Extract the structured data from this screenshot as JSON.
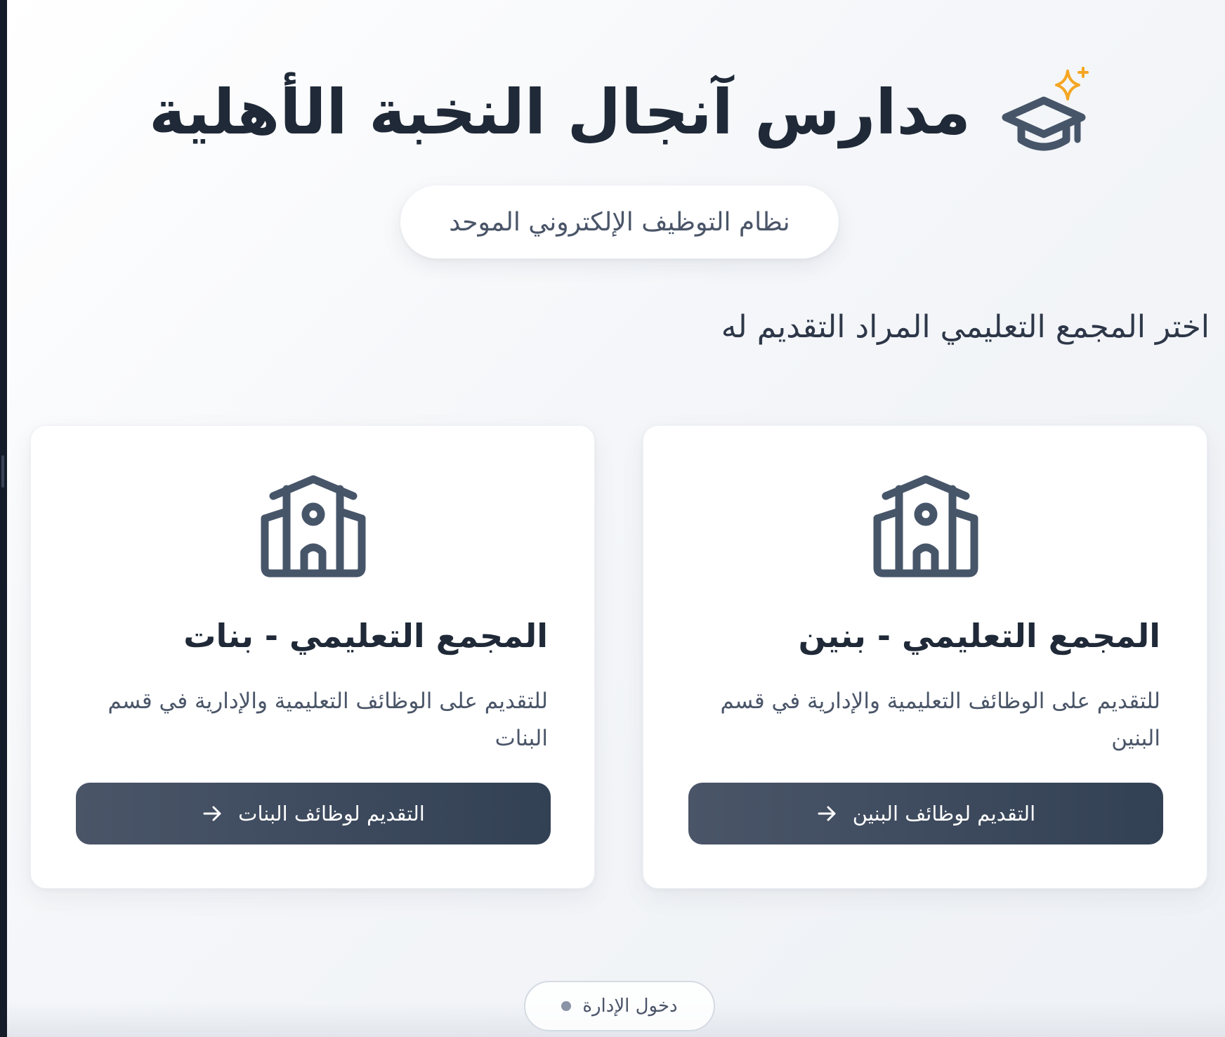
{
  "header": {
    "title": "مدارس آنجال النخبة الأهلية",
    "logo_icon": "graduation-cap-icon",
    "sparkle_icon": "sparkle-icon",
    "sparkle_color": "#f5a623",
    "icon_color": "#475569"
  },
  "subtitle": "نظام التوظيف الإلكتروني الموحد",
  "prompt": "اختر المجمع التعليمي المراد التقديم له",
  "cards": {
    "boys": {
      "icon": "school-building-icon",
      "title": "المجمع التعليمي - بنين",
      "description": "للتقديم على الوظائف التعليمية والإدارية في قسم البنين",
      "button_label": "التقديم لوظائف البنين",
      "button_icon": "arrow-right-icon"
    },
    "girls": {
      "icon": "school-building-icon",
      "title": "المجمع التعليمي - بنات",
      "description": "للتقديم على الوظائف التعليمية والإدارية في قسم البنات",
      "button_label": "التقديم لوظائف البنات",
      "button_icon": "arrow-right-icon"
    }
  },
  "admin": {
    "label": "دخول الإدارة",
    "status_icon": "status-dot-icon"
  },
  "colors": {
    "button_bg": "#3f4a5c",
    "title_text": "#1f2937",
    "body_text": "#4a5568",
    "accent_sparkle": "#f5a623"
  }
}
